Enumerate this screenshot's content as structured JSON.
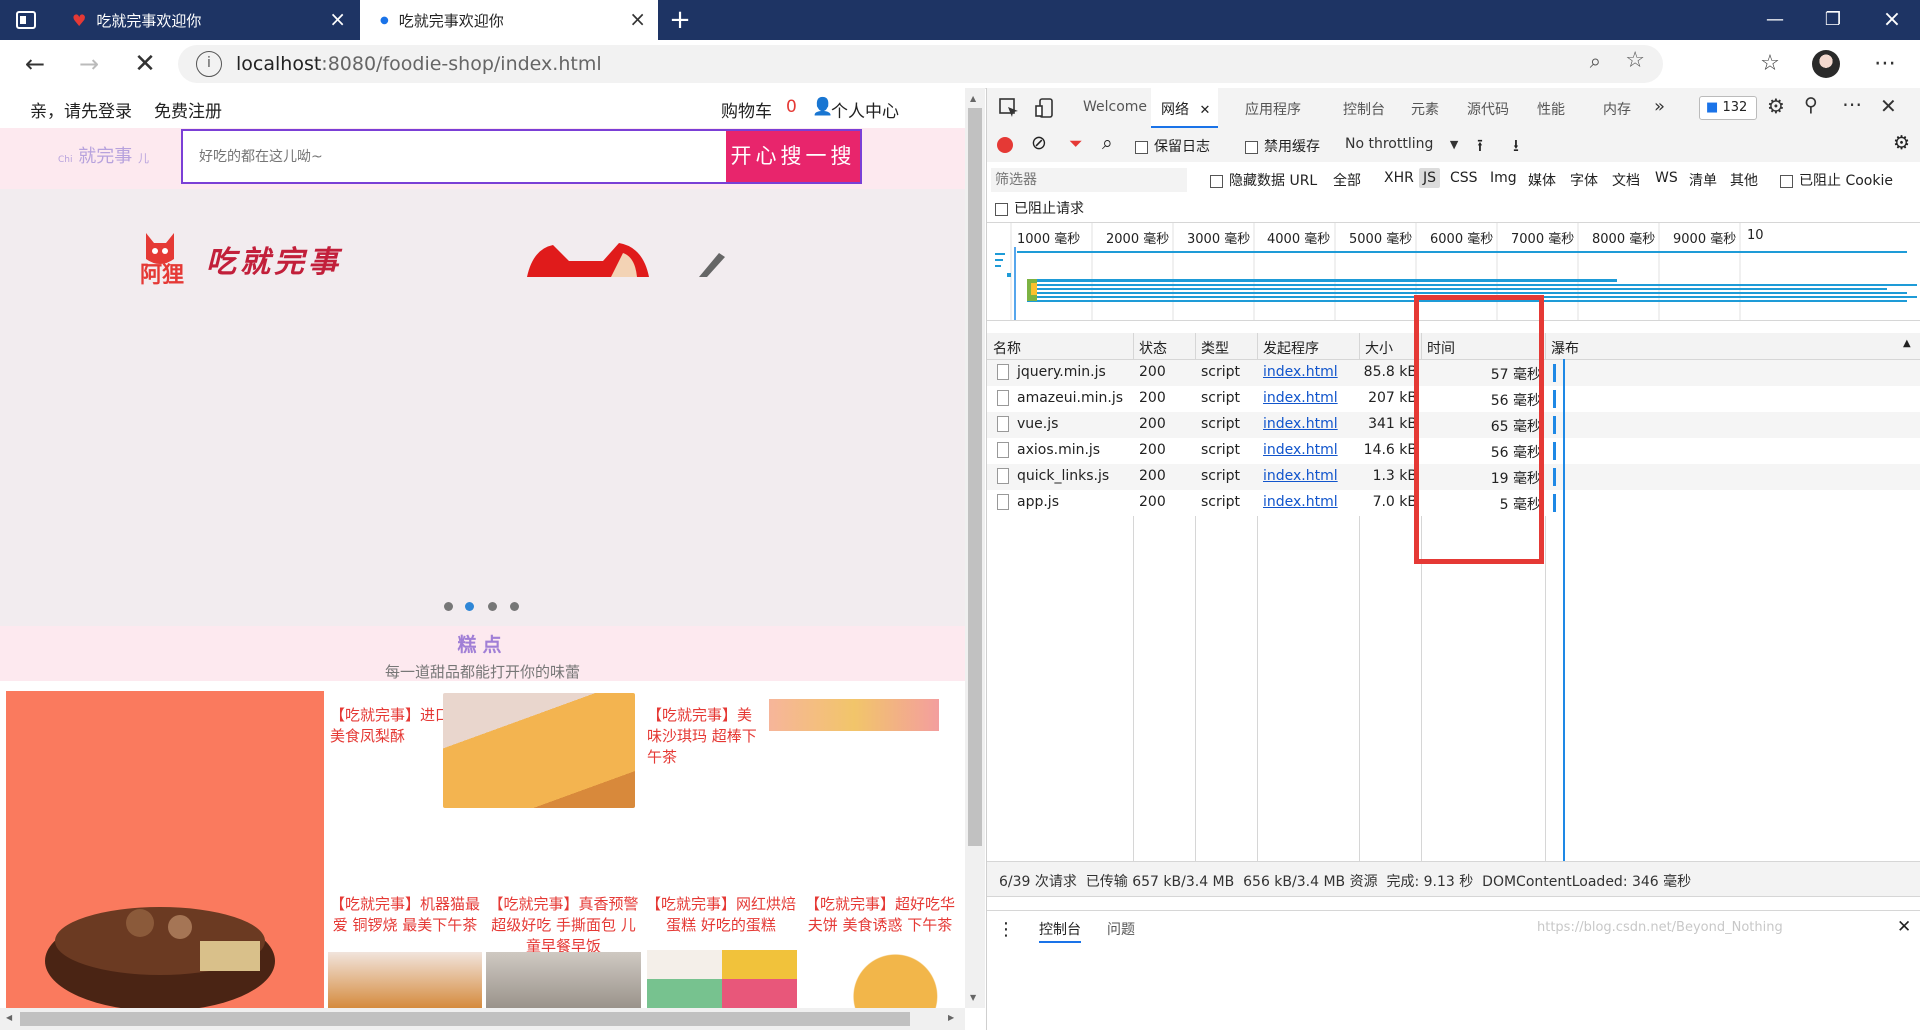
{
  "browser": {
    "tabs": [
      {
        "title": "吃就完事欢迎你",
        "active": false
      },
      {
        "title": "吃就完事欢迎你",
        "active": true
      }
    ],
    "url_host": "localhost",
    "url_rest": ":8080/foodie-shop/index.html"
  },
  "site": {
    "login": "亲，请先登录",
    "register": "免费注册",
    "cart_label": "购物车",
    "cart_count": "0",
    "user_center": "个人中心",
    "logo_text": "就完事",
    "logo_prefix": "Chi",
    "logo_suffix": "儿",
    "search_placeholder": "好吃的都在这儿呦~",
    "search_button": "开心搜一搜",
    "banner_brand": "阿狸",
    "banner_slogan": "吃就完事",
    "section_title": "糕点",
    "section_subtitle": "每一道甜品都能打开你的味蕾",
    "products": [
      "【吃就完事】进口美食凤梨酥",
      "【吃就完事】美味沙琪玛 超棒下午茶",
      "【吃就完事】机器猫最爱 铜锣烧 最美下午茶",
      "【吃就完事】真香预警 超级好吃 手撕面包 儿童早餐早饭",
      "【吃就完事】网红烘焙蛋糕 好吃的蛋糕",
      "【吃就完事】超好吃华夫饼 美食诱惑 下午茶"
    ]
  },
  "devtools": {
    "tabs": [
      "Welcome",
      "网络",
      "应用程序",
      "控制台",
      "元素",
      "源代码",
      "性能",
      "内存"
    ],
    "issue_count": "132",
    "toolbar": {
      "preserve_log": "保留日志",
      "disable_cache": "禁用缓存",
      "throttling": "No throttling"
    },
    "filter": {
      "placeholder": "筛选器",
      "hide_data_urls": "隐藏数据 URL",
      "types": [
        "全部",
        "XHR",
        "JS",
        "CSS",
        "Img",
        "媒体",
        "字体",
        "文档",
        "WS",
        "清单",
        "其他"
      ],
      "active_type": "JS",
      "blocked_cookies": "已阻止 Cookie",
      "blocked_requests": "已阻止请求"
    },
    "timeline_ticks": [
      "1000 毫秒",
      "2000 毫秒",
      "3000 毫秒",
      "4000 毫秒",
      "5000 毫秒",
      "6000 毫秒",
      "7000 毫秒",
      "8000 毫秒",
      "9000 毫秒",
      "10"
    ],
    "columns": [
      "名称",
      "状态",
      "类型",
      "发起程序",
      "大小",
      "时间",
      "瀑布"
    ],
    "rows": [
      {
        "name": "jquery.min.js",
        "status": "200",
        "type": "script",
        "initiator": "index.html",
        "size": "85.8 kB",
        "time": "57 毫秒"
      },
      {
        "name": "amazeui.min.js",
        "status": "200",
        "type": "script",
        "initiator": "index.html",
        "size": "207 kB",
        "time": "56 毫秒"
      },
      {
        "name": "vue.js",
        "status": "200",
        "type": "script",
        "initiator": "index.html",
        "size": "341 kB",
        "time": "65 毫秒"
      },
      {
        "name": "axios.min.js",
        "status": "200",
        "type": "script",
        "initiator": "index.html",
        "size": "14.6 kB",
        "time": "56 毫秒"
      },
      {
        "name": "quick_links.js",
        "status": "200",
        "type": "script",
        "initiator": "index.html",
        "size": "1.3 kB",
        "time": "19 毫秒"
      },
      {
        "name": "app.js",
        "status": "200",
        "type": "script",
        "initiator": "index.html",
        "size": "7.0 kB",
        "time": "5 毫秒"
      }
    ],
    "summary": "6/39 次请求  已传输 657 kB/3.4 MB  656 kB/3.4 MB 资源  完成: 9.13 秒  DOMContentLoaded: 346 毫秒",
    "drawer_tabs": [
      "控制台",
      "问题"
    ],
    "watermark": "https://blog.csdn.net/Beyond_Nothing"
  },
  "colors": {
    "titlebar": "#1e3464",
    "highlight_box": "#e53935",
    "search_button": "#e8256c",
    "section_title": "#a17fd6"
  }
}
